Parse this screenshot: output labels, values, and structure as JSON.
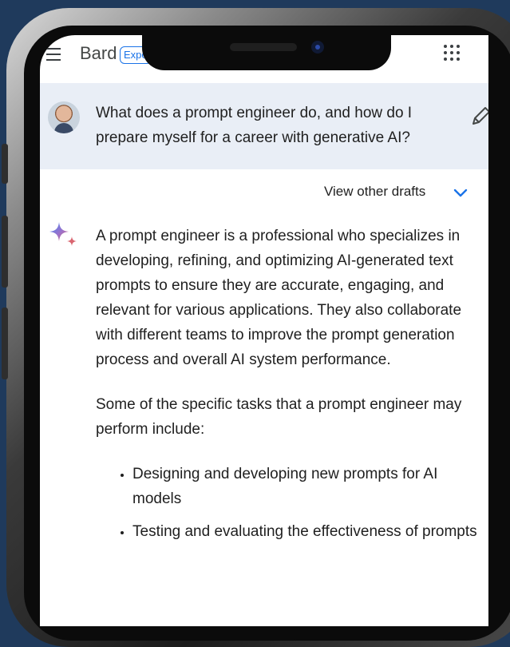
{
  "app": {
    "title": "Bard",
    "badge": "Experiment"
  },
  "prompt": {
    "text": "What does a prompt engineer do, and how do I prepare myself for a career with generative AI?"
  },
  "drafts": {
    "label": "View other drafts"
  },
  "response": {
    "paragraph_1": "A prompt engineer is a professional who specializes in developing, refining, and optimizing AI-generated text prompts to ensure they are accurate, engaging, and relevant for various applications. They also collaborate with different teams to improve the prompt generation process and overall AI system performance.",
    "paragraph_2": "Some of the specific tasks that a prompt engineer may perform include:",
    "bullets": [
      "Designing and developing new prompts for AI models",
      "Testing and evaluating the effectiveness of prompts"
    ]
  },
  "colors": {
    "background": "#1f3a5c",
    "prompt_bg": "#e9eef6",
    "accent": "#1a73e8",
    "text": "#1f1f1f"
  },
  "icons": [
    "menu-icon",
    "apps-grid-icon",
    "edit-icon",
    "chevron-down-icon",
    "sparkle-icon"
  ]
}
